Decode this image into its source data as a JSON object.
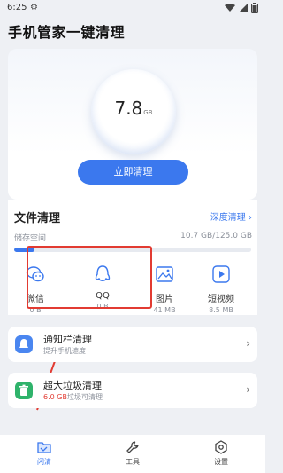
{
  "status": {
    "time": "6:25"
  },
  "app": {
    "title": "手机管家一键清理"
  },
  "storage_circle": {
    "value": "7.8",
    "unit": "GB"
  },
  "clean_button": {
    "label": "立即清理"
  },
  "file_clean": {
    "title": "文件清理",
    "deep_clean": "深度清理 ›",
    "storage_label": "储存空间",
    "storage_value": "10.7 GB/125.0 GB",
    "storage_used_fraction": 0.0856,
    "categories": [
      {
        "label": "微信",
        "size": "0 B",
        "icon": "wechat-icon"
      },
      {
        "label": "QQ",
        "size": "0 B",
        "icon": "qq-icon"
      },
      {
        "label": "图片",
        "size": "41 MB",
        "icon": "picture-icon"
      },
      {
        "label": "短视频",
        "size": "8.5 MB",
        "icon": "video-icon"
      }
    ]
  },
  "notification_clean": {
    "title": "通知栏清理",
    "subtitle": "提升手机速度"
  },
  "large_files": {
    "title": "超大垃圾清理",
    "amount": "6.0 GB",
    "subtitle_suffix": "垃圾可清理"
  },
  "tabs": [
    {
      "label": "闪清",
      "icon": "folder-icon",
      "active": true
    },
    {
      "label": "工具",
      "icon": "wrench-icon",
      "active": false
    },
    {
      "label": "设置",
      "icon": "settings-icon",
      "active": false
    }
  ],
  "colors": {
    "accent": "#3b78ee",
    "highlight": "#e23b32"
  }
}
